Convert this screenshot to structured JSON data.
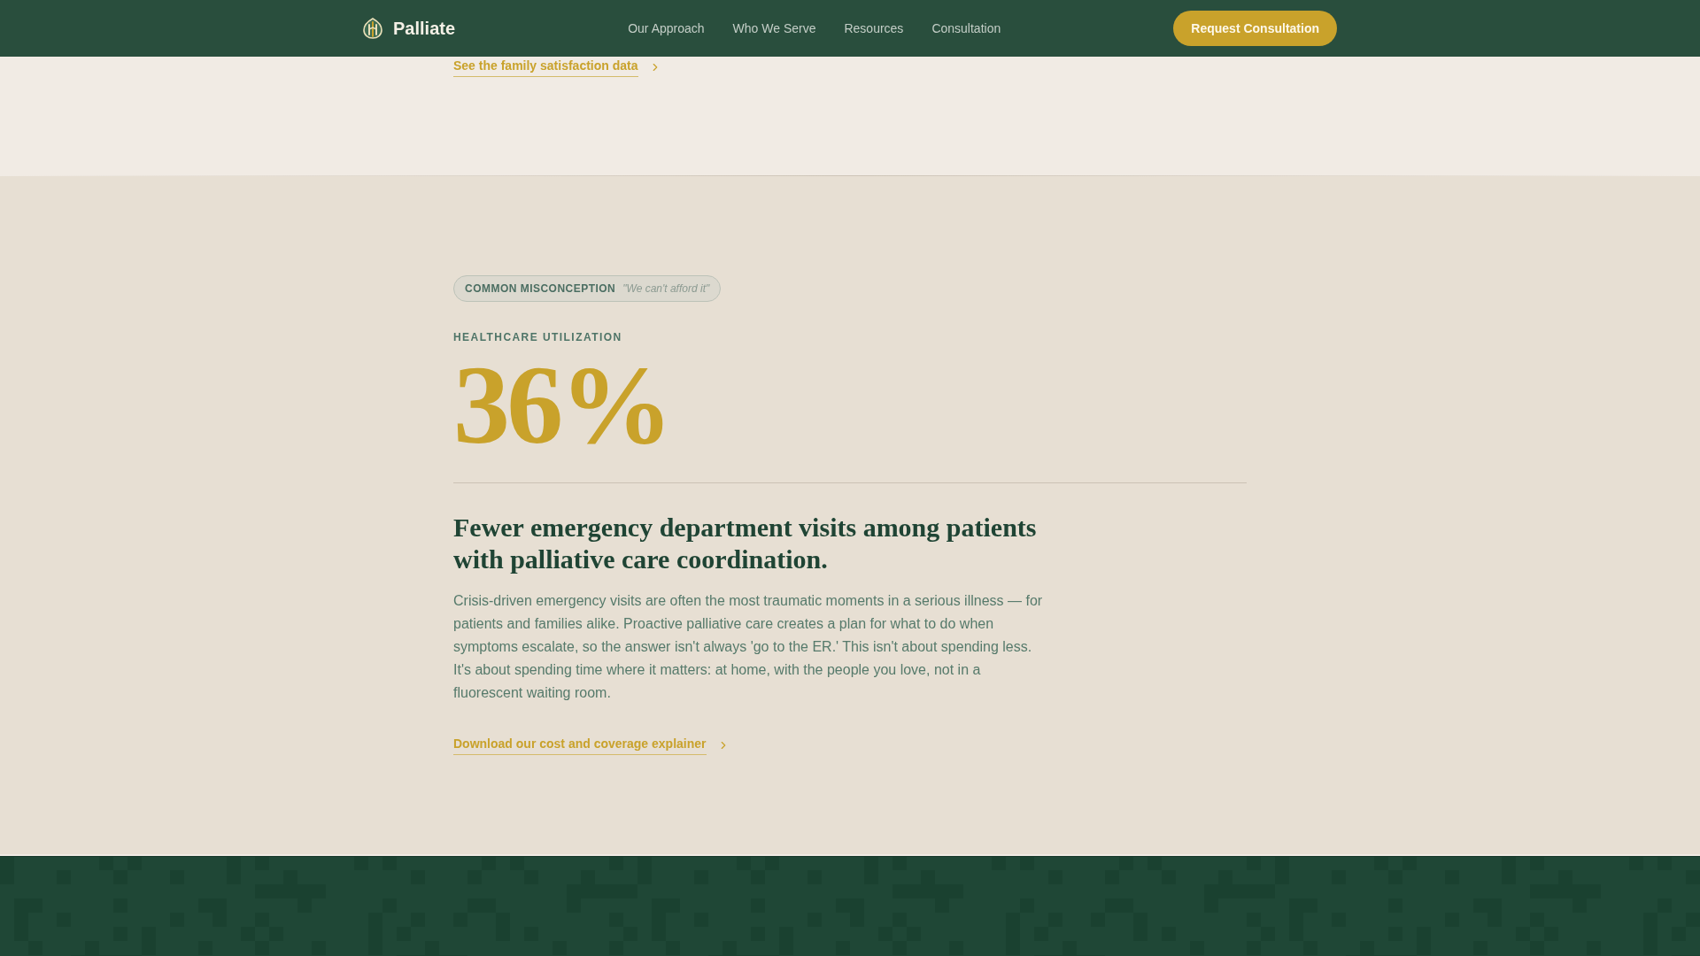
{
  "header": {
    "brand": "Palliate",
    "nav": [
      {
        "label": "Our Approach"
      },
      {
        "label": "Who We Serve"
      },
      {
        "label": "Resources"
      },
      {
        "label": "Consultation"
      }
    ],
    "cta": "Request Consultation"
  },
  "previous_section": {
    "link": "See the family satisfaction data"
  },
  "stat_section": {
    "badge": {
      "label": "COMMON MISCONCEPTION",
      "quote": "\"We can't afford it\""
    },
    "eyebrow": "HEALTHCARE UTILIZATION",
    "stat": "36%",
    "heading": "Fewer emergency department visits among patients with palliative care coordination.",
    "body": "Crisis-driven emergency visits are often the most traumatic moments in a serious illness — for patients and families alike. Proactive palliative care creates a plan for what to do when symptoms escalate, so the answer isn't always 'go to the ER.' This isn't about spending less. It's about spending time where it matters: at home, with the people you love, not in a fluorescent waiting room.",
    "link": "Download our cost and coverage explainer"
  }
}
